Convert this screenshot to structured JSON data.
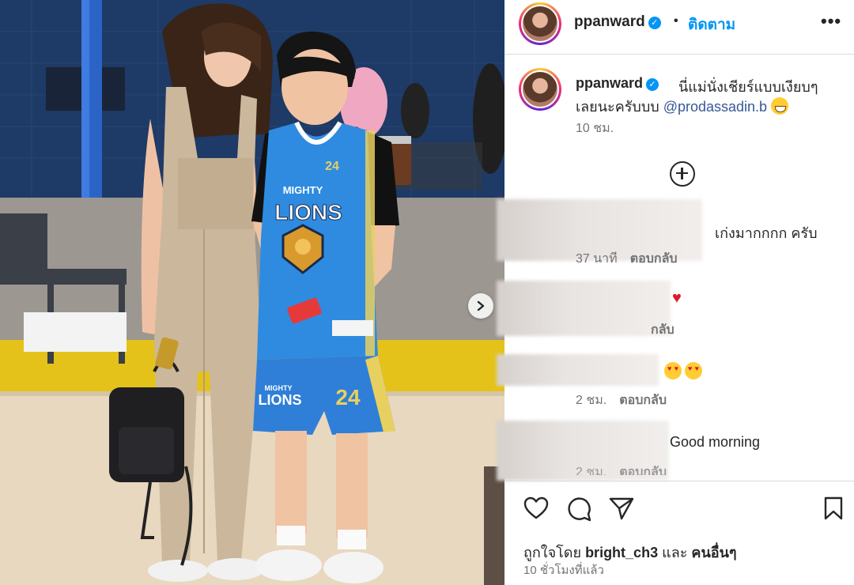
{
  "header": {
    "username": "ppanward",
    "separator": "•",
    "follow_label": "ติดตาม",
    "more_label": "•••"
  },
  "caption": {
    "username": "ppanward",
    "text_line1": "นี่แม่นั่งเชียร์แบบเงียบๆ",
    "text_line2_prefix": "เลยนะครับบบ ",
    "mention": "@prodassadin.b",
    "time": "10 ชม."
  },
  "comments": [
    {
      "text": "เก่งมากกกก ครับ",
      "time": "37 นาที",
      "reply": "ตอบกลับ"
    },
    {
      "text": "",
      "emoji": "red-heart",
      "reply_partial": "กลับ"
    },
    {
      "text": "",
      "emoji": "heart-eyes",
      "time": "2 ชม.",
      "reply": "ตอบกลับ"
    },
    {
      "text": "Good morning",
      "time_partial": "2 ชม.",
      "reply_partial": "ตอบกลับ"
    }
  ],
  "jersey": {
    "team_top": "MIGHTY",
    "team_main": "LIONS",
    "number": "24",
    "shorts_team_top": "MIGHTY",
    "shorts_team_main": "LIONS",
    "shorts_number": "24"
  },
  "likes": {
    "prefix": "ถูกใจโดย",
    "user": "bright_ch3",
    "suffix_and": "และ",
    "suffix_others": "คนอื่นๆ"
  },
  "post_time": "10 ชั่วโมงที่แล้ว",
  "colors": {
    "link_blue": "#0095f6",
    "text": "#262626",
    "muted": "#737373",
    "jersey_blue": "#2f8be0"
  }
}
